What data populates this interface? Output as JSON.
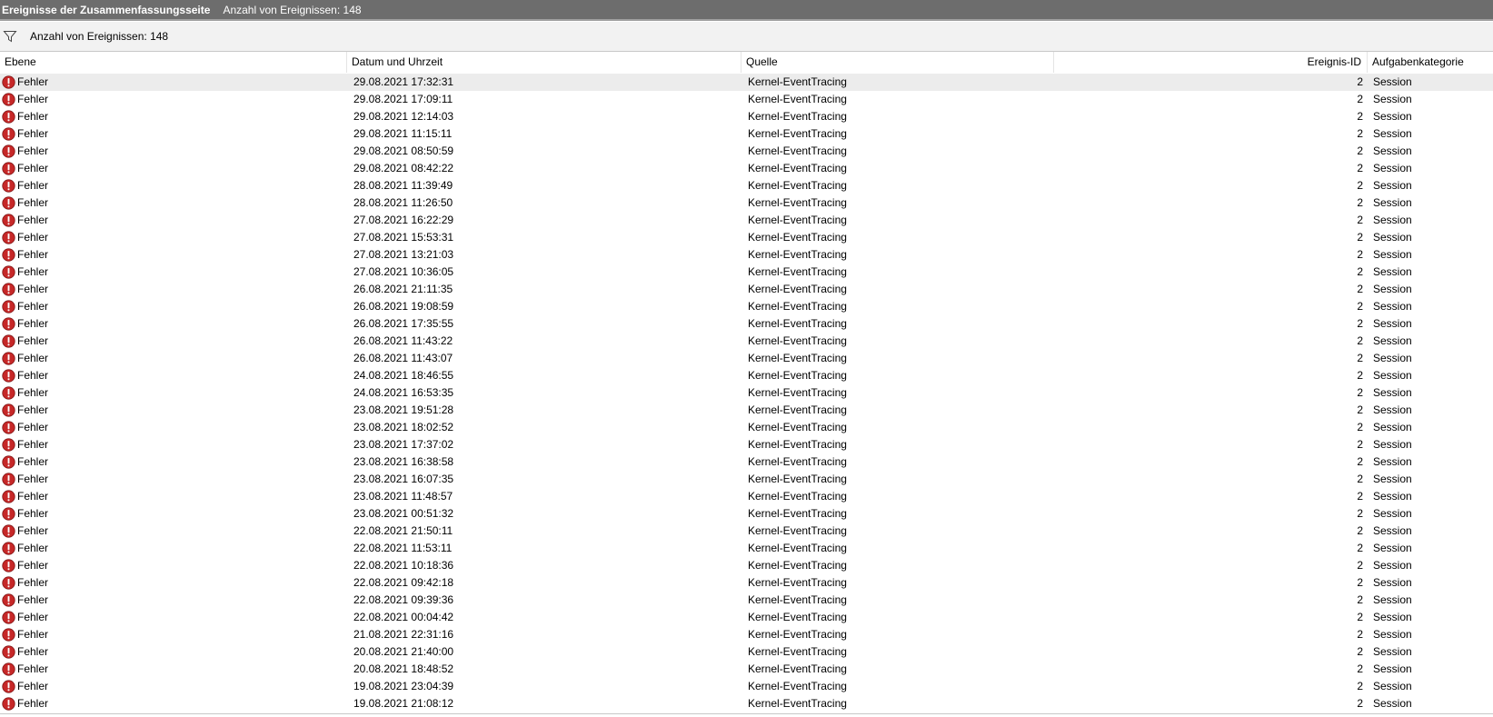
{
  "window": {
    "title": "Ereignisse der Zusammenfassungsseite",
    "subtitle": "Anzahl von Ereignissen: 148"
  },
  "toolbar": {
    "filter_icon": "filter-icon",
    "count_label": "Anzahl von Ereignissen: 148"
  },
  "columns": {
    "level": "Ebene",
    "datetime": "Datum und Uhrzeit",
    "source": "Quelle",
    "event_id": "Ereignis-ID",
    "category": "Aufgabenkategorie"
  },
  "colors": {
    "titlebar_bg": "#6d6d6d",
    "error_icon": "#c62828",
    "selected_row": "#ececec"
  },
  "rows": [
    {
      "level": "Fehler",
      "datetime": "29.08.2021 17:32:31",
      "source": "Kernel-EventTracing",
      "event_id": "2",
      "category": "Session",
      "selected": true
    },
    {
      "level": "Fehler",
      "datetime": "29.08.2021 17:09:11",
      "source": "Kernel-EventTracing",
      "event_id": "2",
      "category": "Session"
    },
    {
      "level": "Fehler",
      "datetime": "29.08.2021 12:14:03",
      "source": "Kernel-EventTracing",
      "event_id": "2",
      "category": "Session"
    },
    {
      "level": "Fehler",
      "datetime": "29.08.2021 11:15:11",
      "source": "Kernel-EventTracing",
      "event_id": "2",
      "category": "Session"
    },
    {
      "level": "Fehler",
      "datetime": "29.08.2021 08:50:59",
      "source": "Kernel-EventTracing",
      "event_id": "2",
      "category": "Session"
    },
    {
      "level": "Fehler",
      "datetime": "29.08.2021 08:42:22",
      "source": "Kernel-EventTracing",
      "event_id": "2",
      "category": "Session"
    },
    {
      "level": "Fehler",
      "datetime": "28.08.2021 11:39:49",
      "source": "Kernel-EventTracing",
      "event_id": "2",
      "category": "Session"
    },
    {
      "level": "Fehler",
      "datetime": "28.08.2021 11:26:50",
      "source": "Kernel-EventTracing",
      "event_id": "2",
      "category": "Session"
    },
    {
      "level": "Fehler",
      "datetime": "27.08.2021 16:22:29",
      "source": "Kernel-EventTracing",
      "event_id": "2",
      "category": "Session"
    },
    {
      "level": "Fehler",
      "datetime": "27.08.2021 15:53:31",
      "source": "Kernel-EventTracing",
      "event_id": "2",
      "category": "Session"
    },
    {
      "level": "Fehler",
      "datetime": "27.08.2021 13:21:03",
      "source": "Kernel-EventTracing",
      "event_id": "2",
      "category": "Session"
    },
    {
      "level": "Fehler",
      "datetime": "27.08.2021 10:36:05",
      "source": "Kernel-EventTracing",
      "event_id": "2",
      "category": "Session"
    },
    {
      "level": "Fehler",
      "datetime": "26.08.2021 21:11:35",
      "source": "Kernel-EventTracing",
      "event_id": "2",
      "category": "Session"
    },
    {
      "level": "Fehler",
      "datetime": "26.08.2021 19:08:59",
      "source": "Kernel-EventTracing",
      "event_id": "2",
      "category": "Session"
    },
    {
      "level": "Fehler",
      "datetime": "26.08.2021 17:35:55",
      "source": "Kernel-EventTracing",
      "event_id": "2",
      "category": "Session"
    },
    {
      "level": "Fehler",
      "datetime": "26.08.2021 11:43:22",
      "source": "Kernel-EventTracing",
      "event_id": "2",
      "category": "Session"
    },
    {
      "level": "Fehler",
      "datetime": "26.08.2021 11:43:07",
      "source": "Kernel-EventTracing",
      "event_id": "2",
      "category": "Session"
    },
    {
      "level": "Fehler",
      "datetime": "24.08.2021 18:46:55",
      "source": "Kernel-EventTracing",
      "event_id": "2",
      "category": "Session"
    },
    {
      "level": "Fehler",
      "datetime": "24.08.2021 16:53:35",
      "source": "Kernel-EventTracing",
      "event_id": "2",
      "category": "Session"
    },
    {
      "level": "Fehler",
      "datetime": "23.08.2021 19:51:28",
      "source": "Kernel-EventTracing",
      "event_id": "2",
      "category": "Session"
    },
    {
      "level": "Fehler",
      "datetime": "23.08.2021 18:02:52",
      "source": "Kernel-EventTracing",
      "event_id": "2",
      "category": "Session"
    },
    {
      "level": "Fehler",
      "datetime": "23.08.2021 17:37:02",
      "source": "Kernel-EventTracing",
      "event_id": "2",
      "category": "Session"
    },
    {
      "level": "Fehler",
      "datetime": "23.08.2021 16:38:58",
      "source": "Kernel-EventTracing",
      "event_id": "2",
      "category": "Session"
    },
    {
      "level": "Fehler",
      "datetime": "23.08.2021 16:07:35",
      "source": "Kernel-EventTracing",
      "event_id": "2",
      "category": "Session"
    },
    {
      "level": "Fehler",
      "datetime": "23.08.2021 11:48:57",
      "source": "Kernel-EventTracing",
      "event_id": "2",
      "category": "Session"
    },
    {
      "level": "Fehler",
      "datetime": "23.08.2021 00:51:32",
      "source": "Kernel-EventTracing",
      "event_id": "2",
      "category": "Session"
    },
    {
      "level": "Fehler",
      "datetime": "22.08.2021 21:50:11",
      "source": "Kernel-EventTracing",
      "event_id": "2",
      "category": "Session"
    },
    {
      "level": "Fehler",
      "datetime": "22.08.2021 11:53:11",
      "source": "Kernel-EventTracing",
      "event_id": "2",
      "category": "Session"
    },
    {
      "level": "Fehler",
      "datetime": "22.08.2021 10:18:36",
      "source": "Kernel-EventTracing",
      "event_id": "2",
      "category": "Session"
    },
    {
      "level": "Fehler",
      "datetime": "22.08.2021 09:42:18",
      "source": "Kernel-EventTracing",
      "event_id": "2",
      "category": "Session"
    },
    {
      "level": "Fehler",
      "datetime": "22.08.2021 09:39:36",
      "source": "Kernel-EventTracing",
      "event_id": "2",
      "category": "Session"
    },
    {
      "level": "Fehler",
      "datetime": "22.08.2021 00:04:42",
      "source": "Kernel-EventTracing",
      "event_id": "2",
      "category": "Session"
    },
    {
      "level": "Fehler",
      "datetime": "21.08.2021 22:31:16",
      "source": "Kernel-EventTracing",
      "event_id": "2",
      "category": "Session"
    },
    {
      "level": "Fehler",
      "datetime": "20.08.2021 21:40:00",
      "source": "Kernel-EventTracing",
      "event_id": "2",
      "category": "Session"
    },
    {
      "level": "Fehler",
      "datetime": "20.08.2021 18:48:52",
      "source": "Kernel-EventTracing",
      "event_id": "2",
      "category": "Session"
    },
    {
      "level": "Fehler",
      "datetime": "19.08.2021 23:04:39",
      "source": "Kernel-EventTracing",
      "event_id": "2",
      "category": "Session"
    },
    {
      "level": "Fehler",
      "datetime": "19.08.2021 21:08:12",
      "source": "Kernel-EventTracing",
      "event_id": "2",
      "category": "Session"
    }
  ]
}
